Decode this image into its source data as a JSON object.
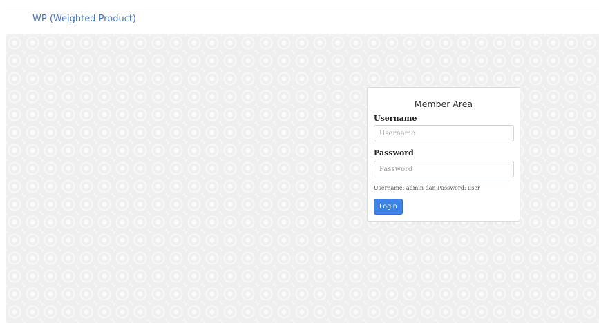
{
  "navbar": {
    "brand": "WP (Weighted Product)"
  },
  "login": {
    "title": "Member Area",
    "username_label": "Username",
    "username_placeholder": "Username",
    "username_value": "",
    "password_label": "Password",
    "password_placeholder": "Password",
    "password_value": "",
    "hint": "Username: admin dan Password: user",
    "button_label": "Login"
  },
  "colors": {
    "brand_text": "#4a78c2",
    "button_bg": "#3d82e6",
    "page_background": "#efefef"
  }
}
